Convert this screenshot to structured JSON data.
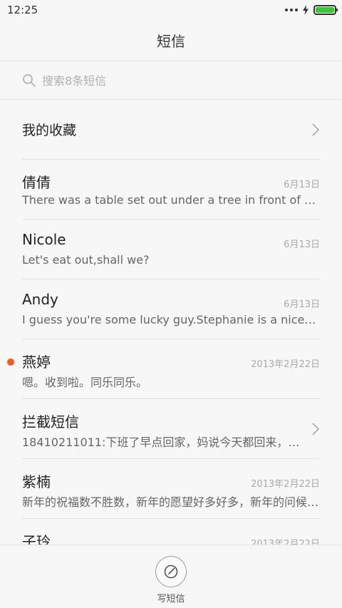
{
  "status_bar": {
    "time": "12:25",
    "icons": [
      "more-dots-icon",
      "charging-bolt-icon",
      "battery-icon"
    ],
    "battery_level": 1.0,
    "battery_color": "#3fc53b"
  },
  "header": {
    "title": "短信"
  },
  "search": {
    "placeholder": "搜索8条短信",
    "icon": "search-icon"
  },
  "favorites": {
    "label": "我的收藏",
    "icon": "chevron-right-icon"
  },
  "conversations": [
    {
      "name": "倩倩",
      "date": "6月13日",
      "snippet": "There was a table set out under a tree in front of the ho…",
      "unread": false
    },
    {
      "name": "Nicole",
      "date": "6月13日",
      "snippet": "Let's eat out,shall we?",
      "unread": false
    },
    {
      "name": "Andy",
      "date": "6月13日",
      "snippet": "I guess you're some lucky guy.Stephanie is a nice girl.",
      "unread": false
    },
    {
      "name": "燕婷",
      "date": "2013年2月22日",
      "snippet": "嗯。收到啦。同乐同乐。",
      "unread": true,
      "unread_color": "#f25a24"
    },
    {
      "name": "拦截短信",
      "date": "",
      "snippet": "18410211011:下班了早点回家，妈说今天都回来，一家…",
      "unread": false,
      "icon": "chevron-right-icon"
    },
    {
      "name": "紫楠",
      "date": "2013年2月22日",
      "snippet": "新年的祝福数不胜数，新年的愿望好多好多，新年的问候…",
      "unread": false
    },
    {
      "name": "子玲",
      "date": "2013年2月22日",
      "snippet": "",
      "unread": false
    }
  ],
  "bottom": {
    "compose_label": "写短信",
    "icon": "compose-icon"
  }
}
